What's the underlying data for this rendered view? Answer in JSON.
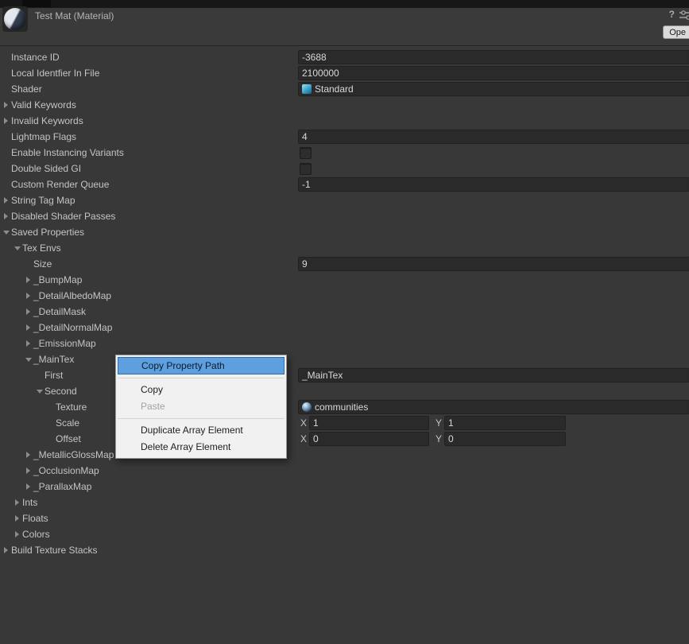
{
  "header": {
    "title": "Test Mat (Material)",
    "help_icon": "?",
    "open_button": "Ope"
  },
  "colors": {
    "panel_bg": "#383838",
    "field_bg": "#2a2a2a",
    "menu_bg": "#f1f1f1",
    "menu_highlight": "#5e9fe0"
  },
  "tree": {
    "xy_labels": {
      "x": "X",
      "y": "Y"
    },
    "rows": [
      {
        "label": "Instance ID",
        "indent": 0,
        "arrow": "none",
        "field": {
          "type": "text",
          "value": "-3688"
        }
      },
      {
        "label": "Local Identfier In File",
        "indent": 0,
        "arrow": "none",
        "field": {
          "type": "text",
          "value": "2100000"
        }
      },
      {
        "label": "Shader",
        "indent": 0,
        "arrow": "none",
        "field": {
          "type": "shader",
          "value": "Standard"
        }
      },
      {
        "label": "Valid Keywords",
        "indent": 0,
        "arrow": "right",
        "field": {
          "type": "none"
        }
      },
      {
        "label": "Invalid Keywords",
        "indent": 0,
        "arrow": "right",
        "field": {
          "type": "none"
        }
      },
      {
        "label": "Lightmap Flags",
        "indent": 0,
        "arrow": "none",
        "field": {
          "type": "text",
          "value": "4"
        }
      },
      {
        "label": "Enable Instancing Variants",
        "indent": 0,
        "arrow": "none",
        "field": {
          "type": "checkbox",
          "checked": false
        }
      },
      {
        "label": "Double Sided GI",
        "indent": 0,
        "arrow": "none",
        "field": {
          "type": "checkbox",
          "checked": false
        }
      },
      {
        "label": "Custom Render Queue",
        "indent": 0,
        "arrow": "none",
        "field": {
          "type": "text",
          "value": "-1"
        }
      },
      {
        "label": "String Tag Map",
        "indent": 0,
        "arrow": "right",
        "field": {
          "type": "none"
        }
      },
      {
        "label": "Disabled Shader Passes",
        "indent": 0,
        "arrow": "right",
        "field": {
          "type": "none"
        }
      },
      {
        "label": "Saved Properties",
        "indent": 0,
        "arrow": "down",
        "field": {
          "type": "none"
        }
      },
      {
        "label": "Tex Envs",
        "indent": 1,
        "arrow": "down",
        "field": {
          "type": "none"
        }
      },
      {
        "label": "Size",
        "indent": 2,
        "arrow": "none",
        "field": {
          "type": "text",
          "value": "9"
        }
      },
      {
        "label": "_BumpMap",
        "indent": 2,
        "arrow": "right",
        "field": {
          "type": "none"
        }
      },
      {
        "label": "_DetailAlbedoMap",
        "indent": 2,
        "arrow": "right",
        "field": {
          "type": "none"
        }
      },
      {
        "label": "_DetailMask",
        "indent": 2,
        "arrow": "right",
        "field": {
          "type": "none"
        }
      },
      {
        "label": "_DetailNormalMap",
        "indent": 2,
        "arrow": "right",
        "field": {
          "type": "none"
        }
      },
      {
        "label": "_EmissionMap",
        "indent": 2,
        "arrow": "right",
        "field": {
          "type": "none"
        }
      },
      {
        "label": "_MainTex",
        "indent": 2,
        "arrow": "down",
        "field": {
          "type": "none"
        }
      },
      {
        "label": "First",
        "indent": 3,
        "arrow": "none",
        "field": {
          "type": "text",
          "value": "_MainTex"
        }
      },
      {
        "label": "Second",
        "indent": 3,
        "arrow": "down",
        "field": {
          "type": "none"
        }
      },
      {
        "label": "Texture",
        "indent": 4,
        "arrow": "none",
        "field": {
          "type": "object",
          "value": "communities"
        }
      },
      {
        "label": "Scale",
        "indent": 4,
        "arrow": "none",
        "field": {
          "type": "xy",
          "x": "1",
          "y": "1"
        }
      },
      {
        "label": "Offset",
        "indent": 4,
        "arrow": "none",
        "field": {
          "type": "xy",
          "x": "0",
          "y": "0"
        }
      },
      {
        "label": "_MetallicGlossMap",
        "indent": 2,
        "arrow": "right",
        "field": {
          "type": "none"
        }
      },
      {
        "label": "_OcclusionMap",
        "indent": 2,
        "arrow": "right",
        "field": {
          "type": "none"
        }
      },
      {
        "label": "_ParallaxMap",
        "indent": 2,
        "arrow": "right",
        "field": {
          "type": "none"
        }
      },
      {
        "label": "Ints",
        "indent": 1,
        "arrow": "right",
        "field": {
          "type": "none"
        }
      },
      {
        "label": "Floats",
        "indent": 1,
        "arrow": "right",
        "field": {
          "type": "none"
        }
      },
      {
        "label": "Colors",
        "indent": 1,
        "arrow": "right",
        "field": {
          "type": "none"
        }
      },
      {
        "label": "Build Texture Stacks",
        "indent": 0,
        "arrow": "right",
        "field": {
          "type": "none"
        }
      }
    ]
  },
  "context_menu": {
    "items": [
      {
        "label": "Copy Property Path",
        "state": "highlighted"
      },
      {
        "label": "Copy",
        "state": "normal"
      },
      {
        "label": "Paste",
        "state": "disabled"
      },
      {
        "label": "Duplicate Array Element",
        "state": "normal"
      },
      {
        "label": "Delete Array Element",
        "state": "normal"
      }
    ]
  }
}
